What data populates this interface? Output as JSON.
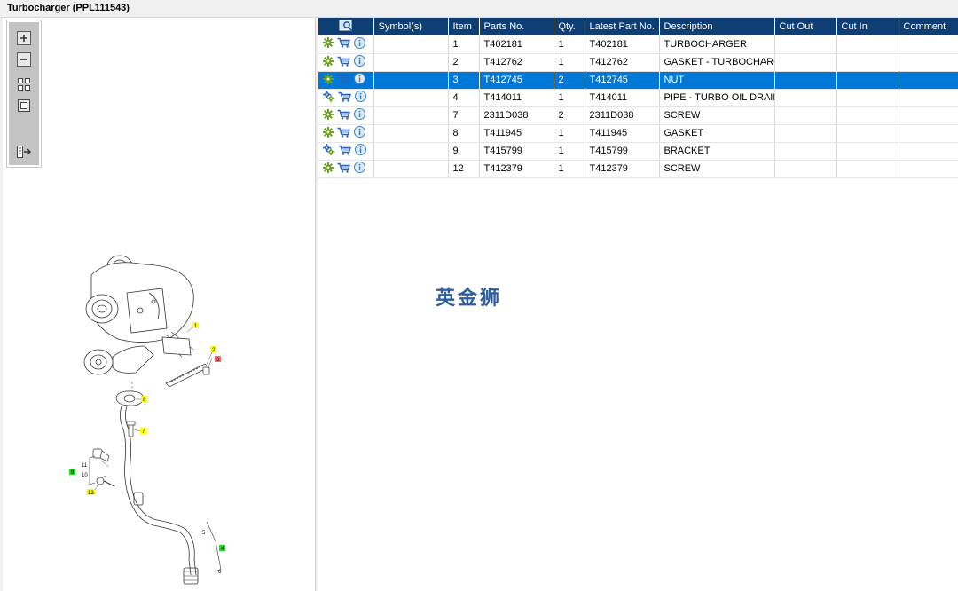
{
  "window": {
    "title": "Turbocharger (PPL111543)"
  },
  "toolbar": {
    "zoom_in": "zoom-in-icon",
    "zoom_out": "zoom-out-icon",
    "fit_all": "fit-all-icon",
    "fit_window": "fit-window-icon",
    "export": "export-icon"
  },
  "table": {
    "columns": [
      "",
      "Symbol(s)",
      "Item",
      "Parts No.",
      "Qty.",
      "Latest Part No.",
      "Description",
      "Cut Out",
      "Cut In",
      "Comment"
    ],
    "rows": [
      {
        "icon_set": "single-gear",
        "symbols": "",
        "item": "1",
        "part_no": "T402181",
        "qty": "1",
        "latest": "T402181",
        "description": "TURBOCHARGER",
        "cut_out": "",
        "cut_in": "",
        "comment": "",
        "selected": false
      },
      {
        "icon_set": "single-gear",
        "symbols": "",
        "item": "2",
        "part_no": "T412762",
        "qty": "1",
        "latest": "T412762",
        "description": "GASKET - TURBOCHARGER",
        "cut_out": "",
        "cut_in": "",
        "comment": "",
        "selected": false
      },
      {
        "icon_set": "single-gear",
        "symbols": "",
        "item": "3",
        "part_no": "T412745",
        "qty": "2",
        "latest": "T412745",
        "description": "NUT",
        "cut_out": "",
        "cut_in": "",
        "comment": "",
        "selected": true
      },
      {
        "icon_set": "double-gear",
        "symbols": "",
        "item": "4",
        "part_no": "T414011",
        "qty": "1",
        "latest": "T414011",
        "description": "PIPE - TURBO OIL DRAIN",
        "cut_out": "",
        "cut_in": "",
        "comment": "",
        "selected": false
      },
      {
        "icon_set": "single-gear",
        "symbols": "",
        "item": "7",
        "part_no": "2311D038",
        "qty": "2",
        "latest": "2311D038",
        "description": "SCREW",
        "cut_out": "",
        "cut_in": "",
        "comment": "",
        "selected": false
      },
      {
        "icon_set": "single-gear",
        "symbols": "",
        "item": "8",
        "part_no": "T411945",
        "qty": "1",
        "latest": "T411945",
        "description": "GASKET",
        "cut_out": "",
        "cut_in": "",
        "comment": "",
        "selected": false
      },
      {
        "icon_set": "double-gear",
        "symbols": "",
        "item": "9",
        "part_no": "T415799",
        "qty": "1",
        "latest": "T415799",
        "description": "BRACKET",
        "cut_out": "",
        "cut_in": "",
        "comment": "",
        "selected": false
      },
      {
        "icon_set": "single-gear",
        "symbols": "",
        "item": "12",
        "part_no": "T412379",
        "qty": "1",
        "latest": "T412379",
        "description": "SCREW",
        "cut_out": "",
        "cut_in": "",
        "comment": "",
        "selected": false
      }
    ]
  },
  "watermark": "英金狮",
  "diagram": {
    "callouts": [
      {
        "label": "1",
        "color": "#ffff00"
      },
      {
        "label": "2",
        "color": "#ffff00"
      },
      {
        "label": "3",
        "color": "#ff6b6b"
      },
      {
        "label": "8",
        "color": "#ffff00"
      },
      {
        "label": "7",
        "color": "#ffff00"
      },
      {
        "label": "9",
        "color": "#22dd22"
      },
      {
        "label": "11",
        "color": ""
      },
      {
        "label": "10",
        "color": ""
      },
      {
        "label": "12",
        "color": "#ffff00"
      },
      {
        "label": "5",
        "color": ""
      },
      {
        "label": "4",
        "color": "#22dd22"
      },
      {
        "label": "6",
        "color": ""
      }
    ]
  },
  "colors": {
    "header": "#0e3e74",
    "selected": "#0078d7",
    "gear": "#6aa121",
    "gear_blue": "#2a63b8",
    "cart": "#2a63b8",
    "info": "#3b82c4"
  }
}
